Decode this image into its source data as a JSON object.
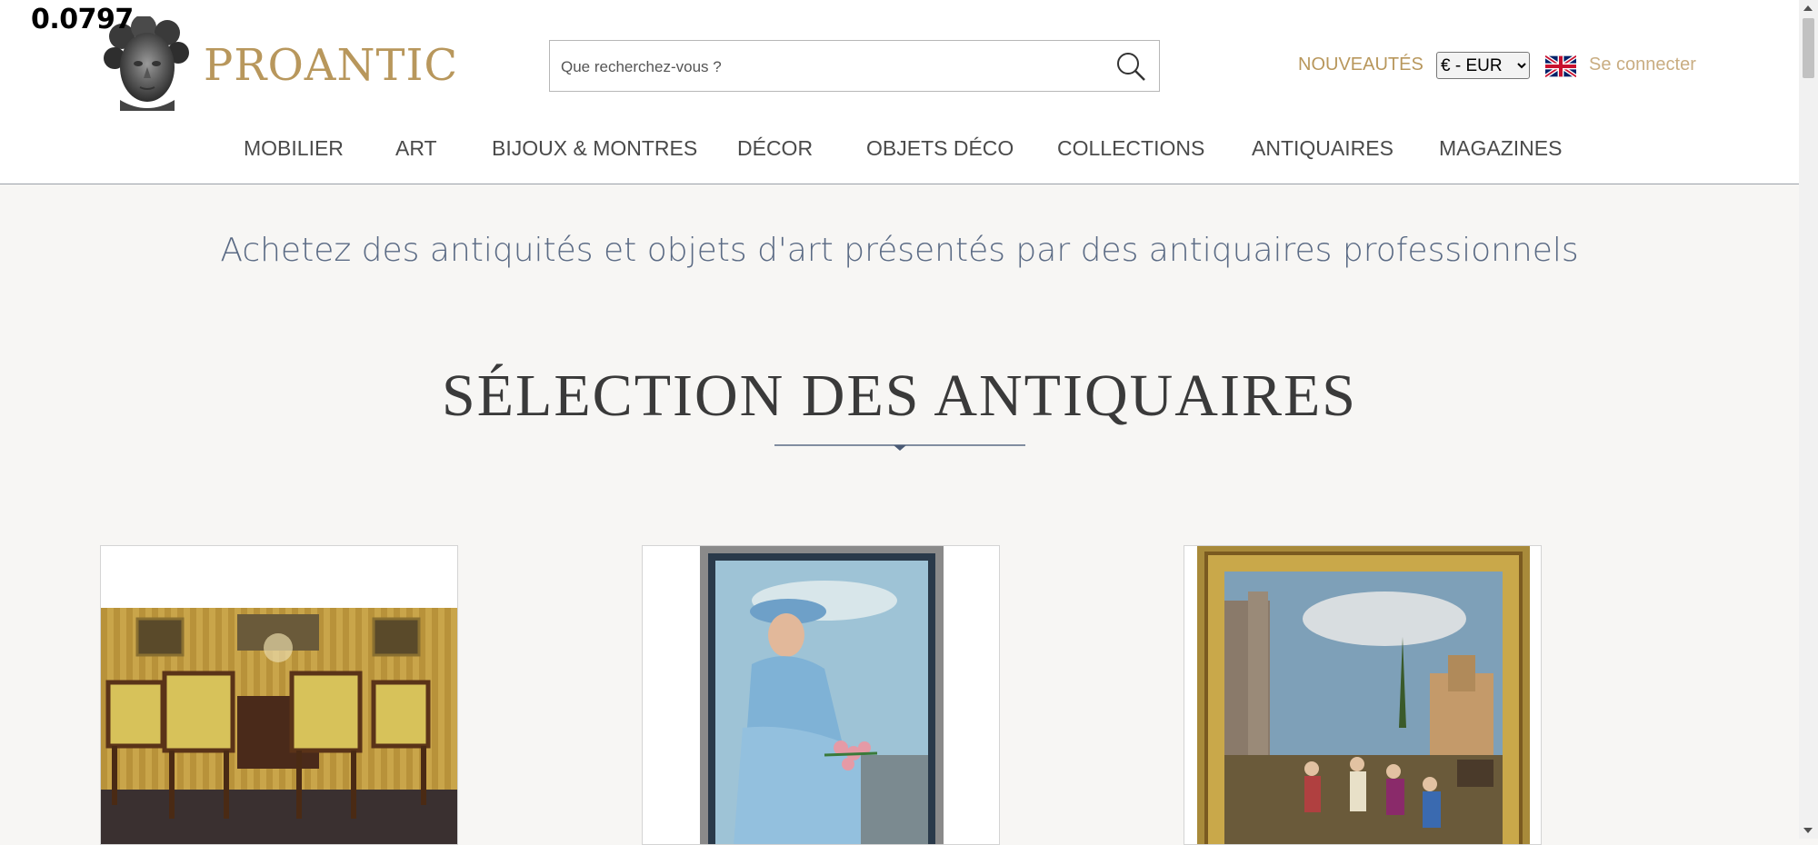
{
  "overlay": {
    "value": "0.0797"
  },
  "brand": {
    "name": "PROANTIC"
  },
  "search": {
    "placeholder": "Que recherchez-vous ?"
  },
  "header": {
    "nouveautes": "NOUVEAUTÉS",
    "currency_selected": "€ - EUR",
    "login": "Se connecter"
  },
  "nav": {
    "items": [
      {
        "label": "MOBILIER"
      },
      {
        "label": "ART"
      },
      {
        "label": "BIJOUX & MONTRES"
      },
      {
        "label": "DÉCOR"
      },
      {
        "label": "OBJETS DÉCO"
      },
      {
        "label": "COLLECTIONS"
      },
      {
        "label": "ANTIQUAIRES"
      },
      {
        "label": "MAGAZINES"
      }
    ]
  },
  "main": {
    "tagline": "Achetez des antiquités et objets d'art présentés par des antiquaires professionnels",
    "section_title": "SÉLECTION DES ANTIQUAIRES"
  },
  "colors": {
    "gold": "#b8975c",
    "nav_text": "#4a4a4a",
    "tagline": "#5a6a84",
    "background": "#f7f6f4"
  },
  "icons": [
    "search-icon",
    "uk-flag-icon",
    "divider-diamond-icon"
  ]
}
